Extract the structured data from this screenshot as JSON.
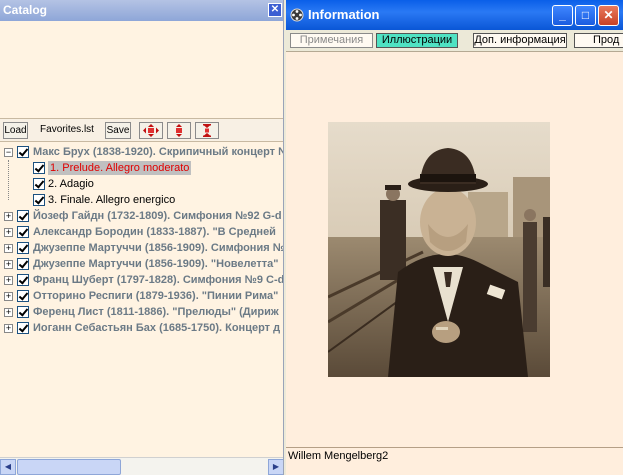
{
  "catalog": {
    "title": "Catalog",
    "close_glyph": "✕",
    "toolbar": {
      "load_label": "Load",
      "file_name": "Favorites.lst",
      "save_label": "Save",
      "icons": [
        "move-all-icon",
        "move-updown-icon",
        "collapse-icon"
      ]
    },
    "items": [
      {
        "label": "Макс Брух (1838-1920). Скрипичный концерт №",
        "expander": "−",
        "children": [
          {
            "label": "1. Prelude.  Allegro moderato",
            "selected": true
          },
          {
            "label": "2. Adagio",
            "selected": false
          },
          {
            "label": "3. Finale. Allegro energico",
            "selected": false
          }
        ]
      },
      {
        "label": "Йозеф Гайдн (1732-1809). Симфония №92 G-d",
        "expander": "+"
      },
      {
        "label": "Александр Бородин (1833-1887). \"В Средней",
        "expander": "+"
      },
      {
        "label": "Джузеппе Мартуччи (1856-1909). Симфония №",
        "expander": "+"
      },
      {
        "label": "Джузеппе Мартуччи (1856-1909). \"Новелетта\"",
        "expander": "+"
      },
      {
        "label": "Франц Шуберт (1797-1828). Симфония №9 C-d",
        "expander": "+"
      },
      {
        "label": "Отторино Респиги (1879-1936). \"Пинии Рима\"",
        "expander": "+"
      },
      {
        "label": "Ференц Лист (1811-1886). \"Прелюды\" (Дириж",
        "expander": "+"
      },
      {
        "label": "Иоганн Себастьян Бах (1685-1750). Концерт д",
        "expander": "+"
      }
    ],
    "scroll_arrows": {
      "left": "◀",
      "right": "▶"
    }
  },
  "info": {
    "title": "Information",
    "window_buttons": {
      "minimize": "_",
      "maximize": "□",
      "close": "✕"
    },
    "tabs": [
      {
        "label": "Примечания",
        "state": "dim"
      },
      {
        "label": "Иллюстрации",
        "state": "active"
      },
      {
        "label": "Доп. информация",
        "state": "normal"
      },
      {
        "label": "Прод",
        "state": "normal"
      }
    ],
    "photo_caption": "Willem Mengelberg2"
  },
  "colors": {
    "catalog_bg": "#fff3e2",
    "info_bg": "#ffeedd",
    "active_tab": "#4fe2c3",
    "selected_track": "#e00000",
    "parent_label": "#6b7a86"
  }
}
